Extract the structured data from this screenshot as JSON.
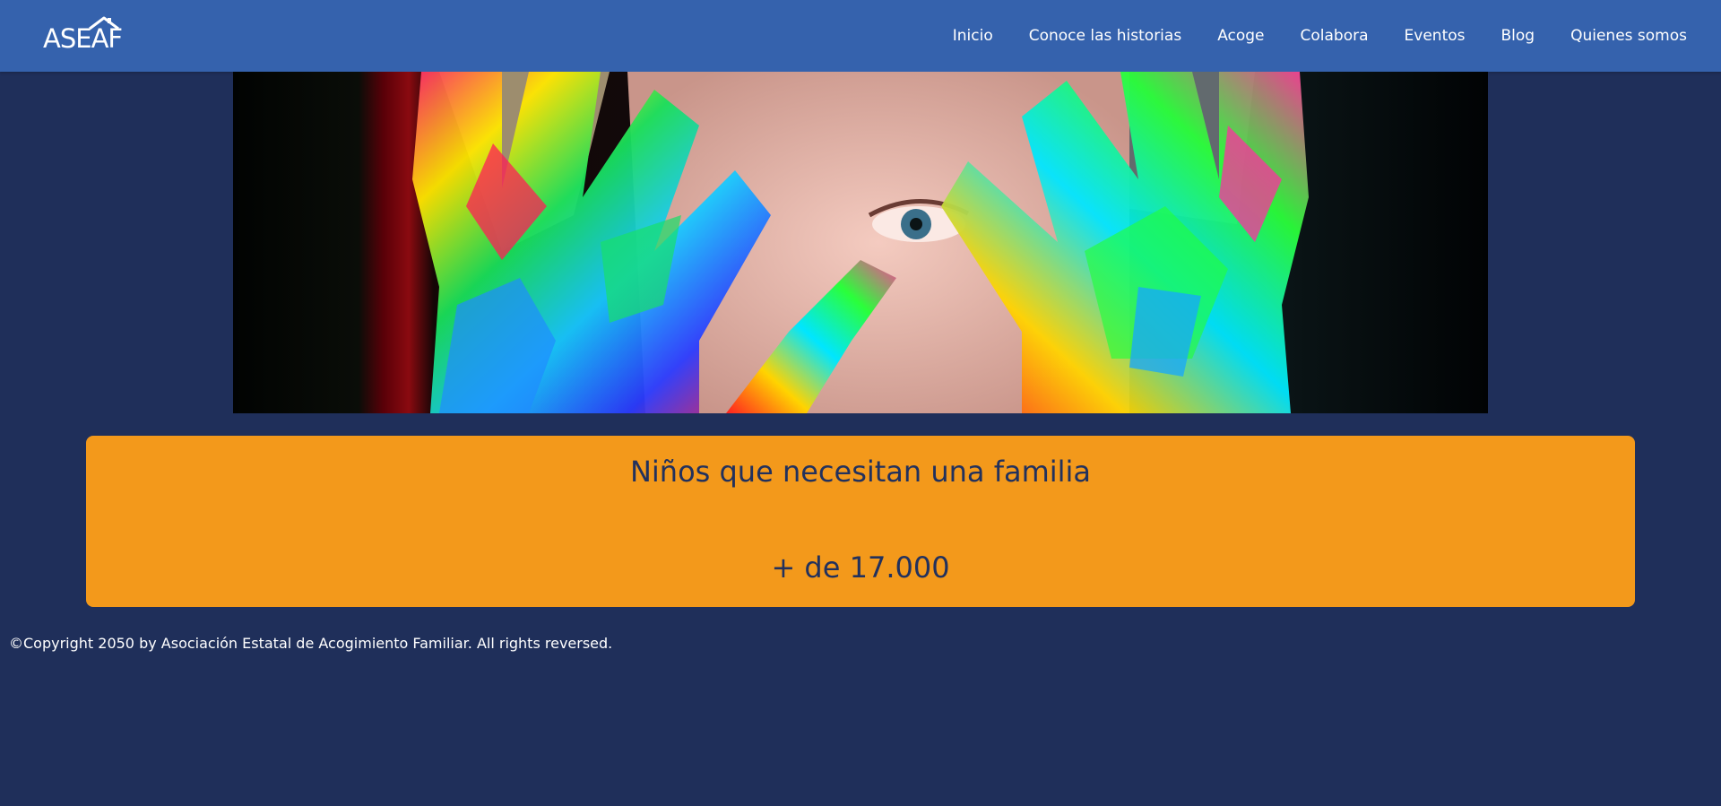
{
  "header": {
    "logo_text": "ASEAF",
    "nav": [
      {
        "label": "Inicio"
      },
      {
        "label": "Conoce las historias"
      },
      {
        "label": "Acoge"
      },
      {
        "label": "Colabora"
      },
      {
        "label": "Eventos"
      },
      {
        "label": "Blog"
      },
      {
        "label": "Quienes somos"
      }
    ]
  },
  "hero": {
    "image": "child-with-paint-covered-hands-photo"
  },
  "stat": {
    "title": "Niños que necesitan una familia",
    "value": "+ de 17.000"
  },
  "footer": {
    "copyright": "©Copyright 2050 by Asociación Estatal de Acogimiento Familiar. All rights reversed."
  },
  "colors": {
    "header_bg": "#3562ad",
    "page_bg": "#1f2f5a",
    "card_bg": "#f3991b",
    "card_text": "#22315d"
  }
}
